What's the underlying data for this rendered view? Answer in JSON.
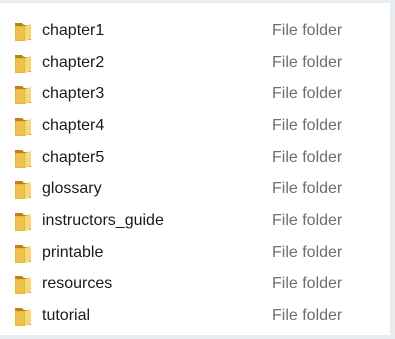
{
  "files": [
    {
      "name": "chapter1",
      "type": "File folder",
      "icon": "folder-icon"
    },
    {
      "name": "chapter2",
      "type": "File folder",
      "icon": "folder-icon"
    },
    {
      "name": "chapter3",
      "type": "File folder",
      "icon": "folder-icon"
    },
    {
      "name": "chapter4",
      "type": "File folder",
      "icon": "folder-icon"
    },
    {
      "name": "chapter5",
      "type": "File folder",
      "icon": "folder-icon"
    },
    {
      "name": "glossary",
      "type": "File folder",
      "icon": "folder-icon"
    },
    {
      "name": "instructors_guide",
      "type": "File folder",
      "icon": "folder-icon"
    },
    {
      "name": "printable",
      "type": "File folder",
      "icon": "folder-icon"
    },
    {
      "name": "resources",
      "type": "File folder",
      "icon": "folder-icon"
    },
    {
      "name": "tutorial",
      "type": "File folder",
      "icon": "folder-icon"
    }
  ],
  "colors": {
    "folder_body": "#e8b73a",
    "folder_dark": "#b98512",
    "folder_light": "#f7d77a",
    "name_text": "#1a1a1a",
    "type_text": "#6d6d6d"
  }
}
